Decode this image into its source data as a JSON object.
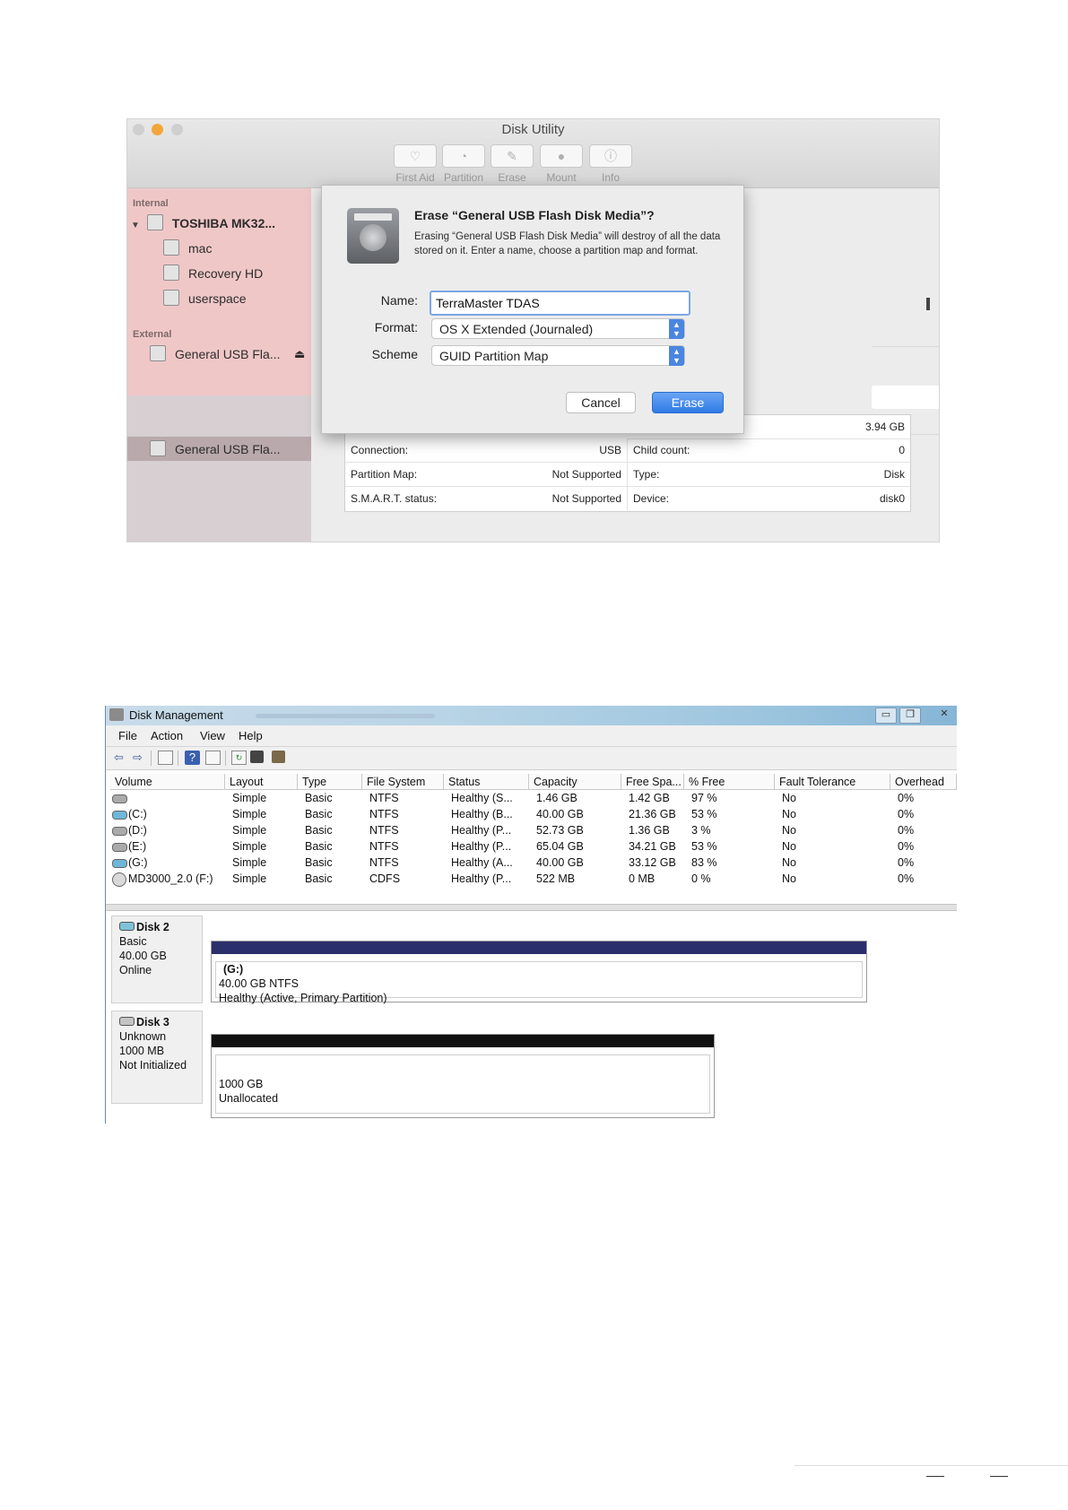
{
  "mac": {
    "window_title": "Disk Utility",
    "toolbar": [
      {
        "label": "First Aid",
        "icon": "stethoscope-icon"
      },
      {
        "label": "Partition",
        "icon": "partition-icon"
      },
      {
        "label": "Erase",
        "icon": "erase-icon"
      },
      {
        "label": "Mount",
        "icon": "mount-icon"
      },
      {
        "label": "Info",
        "icon": "info-icon"
      }
    ],
    "sidebar": {
      "internal_label": "Internal",
      "external_label": "External",
      "items": [
        {
          "label": "TOSHIBA MK32..."
        },
        {
          "label": "mac"
        },
        {
          "label": "Recovery HD"
        },
        {
          "label": "userspace"
        },
        {
          "label": "General USB Fla..."
        },
        {
          "label": "General USB Fla..."
        }
      ],
      "eject_glyph": "⏏"
    },
    "dialog": {
      "title": "Erase “General USB Flash Disk Media”?",
      "description": "Erasing “General USB Flash Disk Media” will destroy of all the data stored on it. Enter a name, choose a partition map and format.",
      "name_label": "Name:",
      "name_value": "TerraMaster TDAS",
      "format_label": "Format:",
      "format_value": "OS X Extended (Journaled)",
      "scheme_label": "Scheme",
      "scheme_value": "GUID Partition Map",
      "cancel_label": "Cancel",
      "erase_label": "Erase"
    },
    "info": {
      "capacity_value": "3.94 GB",
      "rows": [
        {
          "k1": "Connection:",
          "v1": "USB",
          "k2": "Child count:",
          "v2": "0"
        },
        {
          "k1": "Partition Map:",
          "v1": "Not Supported",
          "k2": "Type:",
          "v2": "Disk"
        },
        {
          "k1": "S.M.A.R.T. status:",
          "v1": "Not Supported",
          "k2": "Device:",
          "v2": "disk0"
        }
      ]
    }
  },
  "win": {
    "window_title": "Disk Management",
    "controls": {
      "minimize": "▭",
      "restore": "❐",
      "close": "✕"
    },
    "menu": [
      "File",
      "Action",
      "View",
      "Help"
    ],
    "toolbar_glyphs": {
      "back": "⇦",
      "forward": "⇨",
      "help": "?",
      "refresh": "↻"
    },
    "columns": [
      "Volume",
      "Layout",
      "Type",
      "File System",
      "Status",
      "Capacity",
      "Free Spa...",
      "% Free",
      "Fault Tolerance",
      "Overhead"
    ],
    "rows": [
      {
        "volume": "",
        "icon": "disk",
        "layout": "Simple",
        "type": "Basic",
        "fs": "NTFS",
        "status": "Healthy (S...",
        "capacity": "1.46 GB",
        "free": "1.42 GB",
        "pct": "97 %",
        "fault": "No",
        "overhead": "0%"
      },
      {
        "volume": "(C:)",
        "icon": "disk-blue",
        "layout": "Simple",
        "type": "Basic",
        "fs": "NTFS",
        "status": "Healthy (B...",
        "capacity": "40.00 GB",
        "free": "21.36 GB",
        "pct": "53 %",
        "fault": "No",
        "overhead": "0%"
      },
      {
        "volume": "(D:)",
        "icon": "disk",
        "layout": "Simple",
        "type": "Basic",
        "fs": "NTFS",
        "status": "Healthy (P...",
        "capacity": "52.73 GB",
        "free": "1.36 GB",
        "pct": "3 %",
        "fault": "No",
        "overhead": "0%"
      },
      {
        "volume": "(E:)",
        "icon": "disk",
        "layout": "Simple",
        "type": "Basic",
        "fs": "NTFS",
        "status": "Healthy (P...",
        "capacity": "65.04 GB",
        "free": "34.21 GB",
        "pct": "53 %",
        "fault": "No",
        "overhead": "0%"
      },
      {
        "volume": "(G:)",
        "icon": "disk-blue",
        "layout": "Simple",
        "type": "Basic",
        "fs": "NTFS",
        "status": "Healthy (A...",
        "capacity": "40.00 GB",
        "free": "33.12 GB",
        "pct": "83 %",
        "fault": "No",
        "overhead": "0%"
      },
      {
        "volume": "MD3000_2.0 (F:)",
        "icon": "cd",
        "layout": "Simple",
        "type": "Basic",
        "fs": "CDFS",
        "status": "Healthy (P...",
        "capacity": "522 MB",
        "free": "0 MB",
        "pct": "0 %",
        "fault": "No",
        "overhead": "0%"
      }
    ],
    "disks": [
      {
        "name": "Disk 2",
        "line1": "Basic",
        "line2": "40.00 GB",
        "line3": "Online",
        "part_title": "(G:)",
        "part_line1": "40.00 GB NTFS",
        "part_line2": "Healthy (Active, Primary Partition)",
        "bar_color": "#2b2f6b"
      },
      {
        "name": "Disk 3",
        "line1": "Unknown",
        "line2": "1000 MB",
        "line3": "Not Initialized",
        "part_title": "",
        "part_line1": "1000 GB",
        "part_line2": "Unallocated",
        "bar_color": "#111111"
      }
    ]
  }
}
